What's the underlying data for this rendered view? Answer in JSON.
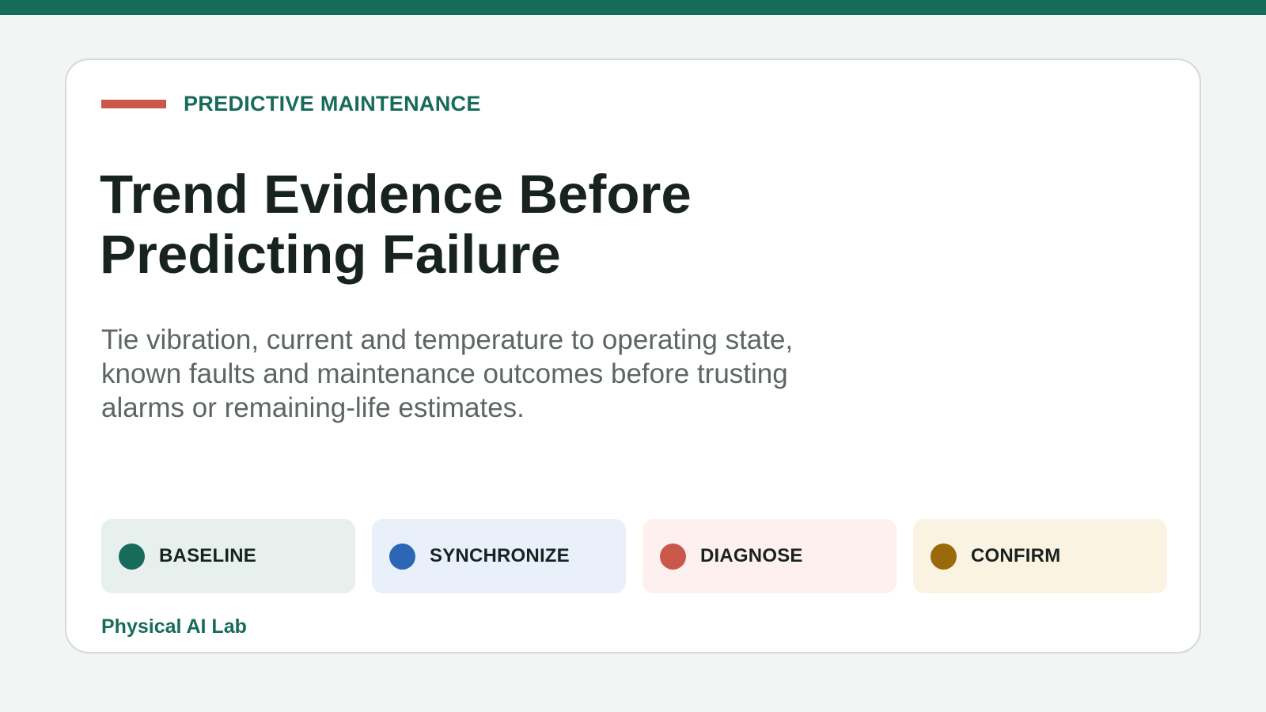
{
  "eyebrow": "PREDICTIVE MAINTENANCE",
  "title": "Trend Evidence Before Predicting Failure",
  "subtitle": "Tie vibration, current and temperature to operating state, known faults and maintenance outcomes before trusting alarms or remaining-life estimates.",
  "steps": [
    {
      "label": "BASELINE",
      "dot_color": "#176b5a",
      "bg_color": "#e7f0ed"
    },
    {
      "label": "SYNCHRONIZE",
      "dot_color": "#2c67b5",
      "bg_color": "#e9f0fa"
    },
    {
      "label": "DIAGNOSE",
      "dot_color": "#c9574a",
      "bg_color": "#fdf0ee"
    },
    {
      "label": "CONFIRM",
      "dot_color": "#9a6a0a",
      "bg_color": "#fbf3e2"
    }
  ],
  "footer": "Physical AI Lab",
  "colors": {
    "accent": "#176b5a",
    "rule": "#c9574a",
    "background": "#f3f5f4"
  }
}
